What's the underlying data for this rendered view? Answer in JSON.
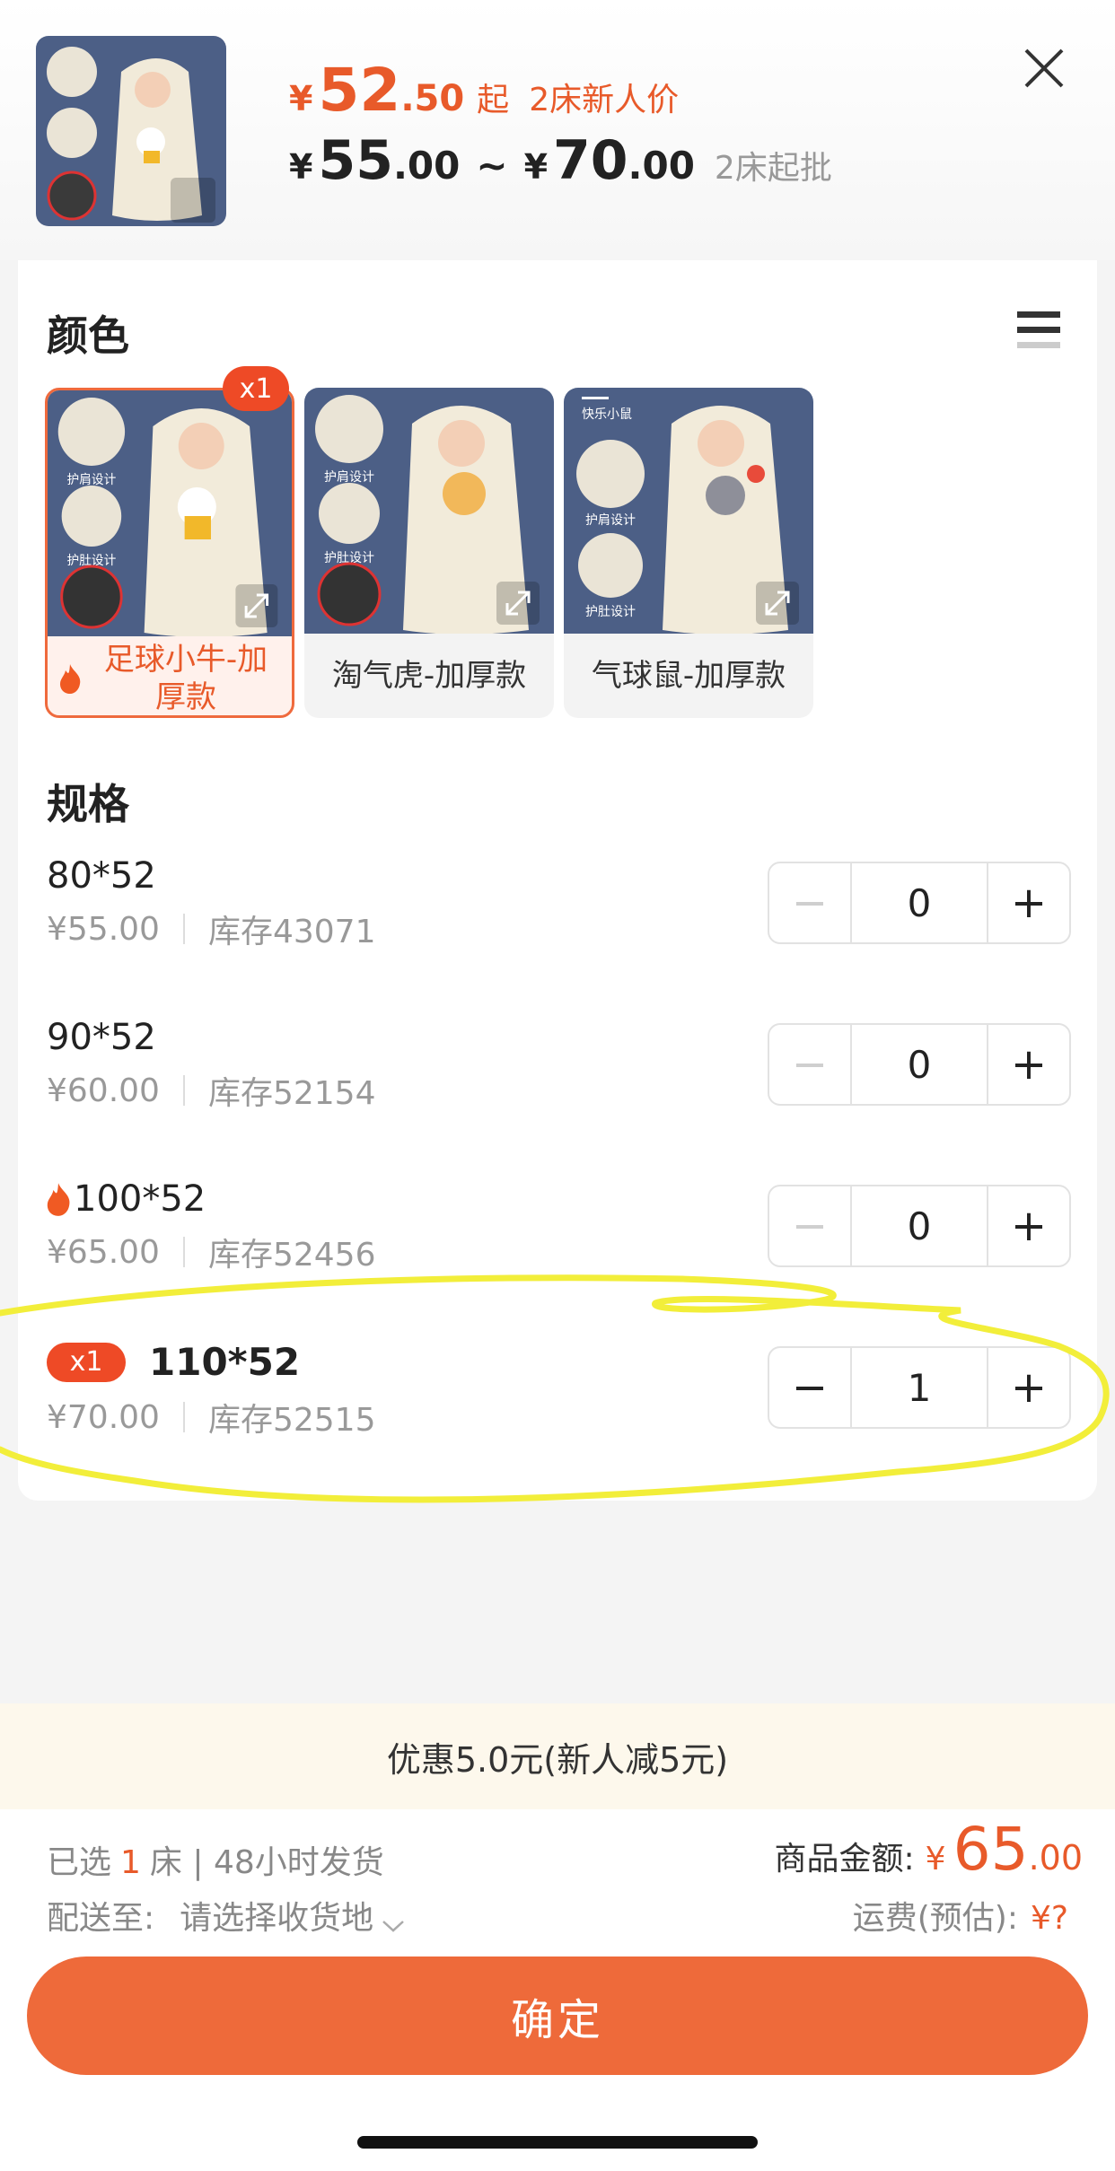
{
  "header": {
    "price_low": {
      "yen": "¥",
      "int": "52",
      "dec": ".50",
      "qi": "起",
      "tag": "2床新人价"
    },
    "price_range": {
      "yen1": "¥",
      "int1": "55",
      "dec1": ".00",
      "tilde": "~",
      "yen2": "¥",
      "int2": "70",
      "dec2": ".00",
      "moq": "2床起批"
    }
  },
  "color_section": {
    "title": "颜色",
    "selected_badge": "x1",
    "options": [
      {
        "label": "足球小牛-加厚款",
        "selected": true
      },
      {
        "label": "淘气虎-加厚款",
        "selected": false
      },
      {
        "label": "气球鼠-加厚款",
        "selected": false
      }
    ],
    "image_text": {
      "shoulder": "护肩设计",
      "belly": "护肚设计",
      "happy_mouse": "快乐小鼠"
    }
  },
  "spec_section": {
    "title": "规格",
    "rows": [
      {
        "name": "80*52",
        "price": "¥55.00",
        "stock": "库存43071",
        "qty": "0"
      },
      {
        "name": "90*52",
        "price": "¥60.00",
        "stock": "库存52154",
        "qty": "0"
      },
      {
        "name": "100*52",
        "price": "¥65.00",
        "stock": "库存52456",
        "qty": "0",
        "hot": true
      },
      {
        "name": "110*52",
        "price": "¥70.00",
        "stock": "库存52515",
        "qty": "1",
        "badge": "x1"
      }
    ]
  },
  "promo": {
    "text": "优惠5.0元(新人减5元)"
  },
  "summary": {
    "selected_prefix": "已选",
    "selected_count": "1",
    "selected_suffix": "床 | 48小时发货",
    "ship_label": "配送至:",
    "ship_value": "请选择收货地",
    "amount_label": "商品金额:",
    "amount_yen": "¥",
    "amount_int": "65",
    "amount_dec": ".00",
    "freight_label": "运费(预估):",
    "freight_value": "¥?"
  },
  "confirm_button": {
    "label": "确定"
  },
  "colors": {
    "accent": "#ee6a3a",
    "price": "#e85a2a",
    "badge": "#ee4a26",
    "highlight": "#f2ee3a",
    "promo_bg": "#fdf8ec"
  }
}
